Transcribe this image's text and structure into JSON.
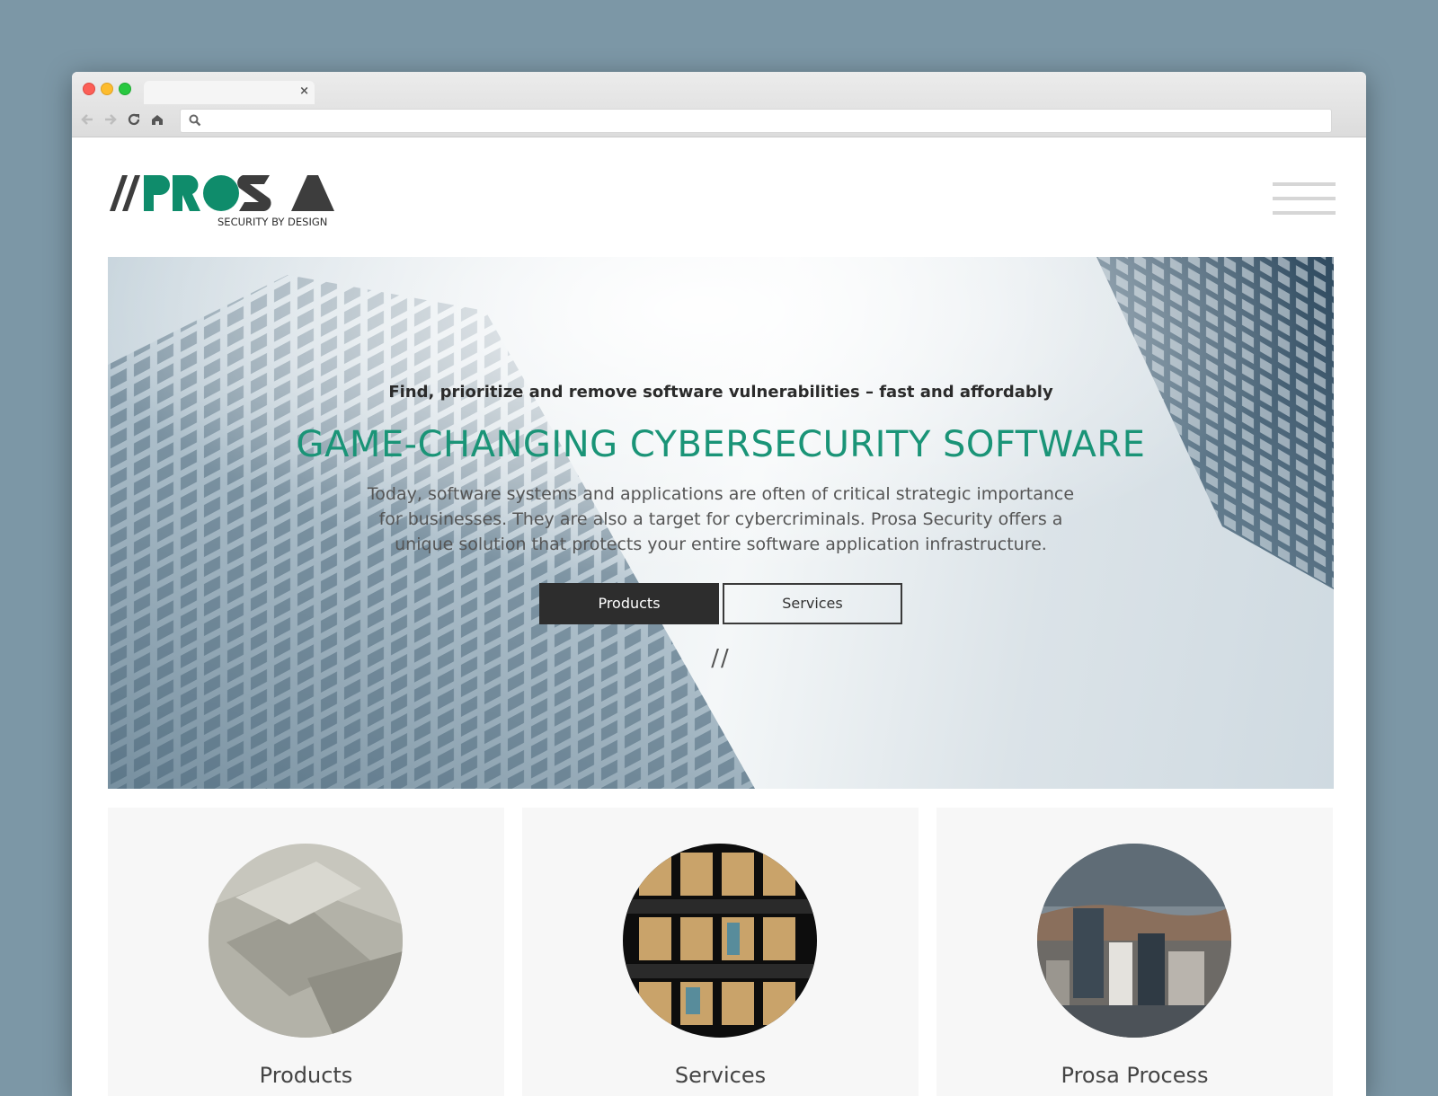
{
  "browser": {
    "tab_close": "×"
  },
  "logo": {
    "slashes": "//",
    "name_green": "PRO",
    "name_dark": "SA",
    "tagline": "SECURITY BY DESIGN",
    "colors": {
      "green": "#0f8c6b",
      "dark": "#3d3d3d"
    }
  },
  "hero": {
    "tagline": "Find, prioritize and remove software vulnerabilities – fast and affordably",
    "title": "GAME-CHANGING CYBERSECURITY SOFTWARE",
    "description": "Today, software systems and applications are often of critical strategic importance for businesses. They are also a target for cybercriminals. Prosa Security offers a unique solution that protects your entire software application infrastructure.",
    "buttons": {
      "products": "Products",
      "services": "Services"
    },
    "divider": "//"
  },
  "cards": [
    {
      "title": "Products",
      "image": "concrete-abstract"
    },
    {
      "title": "Services",
      "image": "office-windows-night"
    },
    {
      "title": "Prosa Process",
      "image": "city-skyline"
    }
  ],
  "colors": {
    "accent": "#1a9477",
    "button_dark": "#2d2d2d",
    "card_bg": "#f7f7f7",
    "backdrop": "#7c97a6"
  }
}
